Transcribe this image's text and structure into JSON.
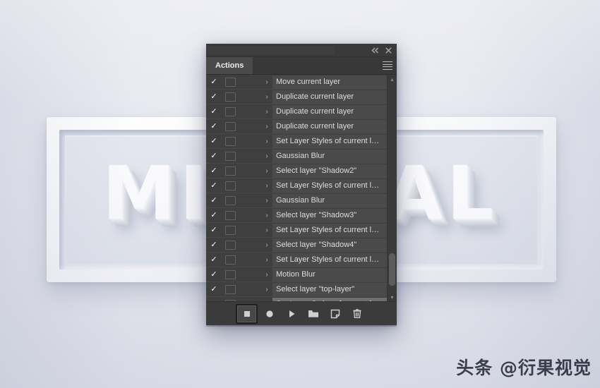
{
  "background": {
    "artwork_word": "MINIMAL",
    "frame_style": "3d-white-picture-frame",
    "base_color": "#e4e6ee"
  },
  "panel": {
    "titlebar": {
      "collapse_label": "«",
      "close_label": "✕"
    },
    "tab": {
      "label": "Actions",
      "menu_icon": "hamburger-menu-icon"
    },
    "rows": [
      {
        "checked": "✓",
        "expand": "›",
        "label": "Move current layer",
        "selected": false
      },
      {
        "checked": "✓",
        "expand": "›",
        "label": "Duplicate current layer",
        "selected": false
      },
      {
        "checked": "✓",
        "expand": "›",
        "label": "Duplicate current layer",
        "selected": false
      },
      {
        "checked": "✓",
        "expand": "›",
        "label": "Duplicate current layer",
        "selected": false
      },
      {
        "checked": "✓",
        "expand": "›",
        "label": "Set Layer Styles of current layer",
        "selected": false
      },
      {
        "checked": "✓",
        "expand": "›",
        "label": "Gaussian Blur",
        "selected": false
      },
      {
        "checked": "✓",
        "expand": "›",
        "label": "Select layer \"Shadow2\"",
        "selected": false
      },
      {
        "checked": "✓",
        "expand": "›",
        "label": "Set Layer Styles of current layer",
        "selected": false
      },
      {
        "checked": "✓",
        "expand": "›",
        "label": "Gaussian Blur",
        "selected": false
      },
      {
        "checked": "✓",
        "expand": "›",
        "label": "Select layer \"Shadow3\"",
        "selected": false
      },
      {
        "checked": "✓",
        "expand": "›",
        "label": "Set Layer Styles of current layer",
        "selected": false
      },
      {
        "checked": "✓",
        "expand": "›",
        "label": "Select layer \"Shadow4\"",
        "selected": false
      },
      {
        "checked": "✓",
        "expand": "›",
        "label": "Set Layer Styles of current layer",
        "selected": false
      },
      {
        "checked": "✓",
        "expand": "›",
        "label": "Motion Blur",
        "selected": false
      },
      {
        "checked": "✓",
        "expand": "›",
        "label": "Select layer \"top-layer\"",
        "selected": false
      },
      {
        "checked": "✓",
        "expand": "›",
        "label": "Set Layer Styles of current layer",
        "selected": true
      }
    ],
    "scrollbar": {
      "up_arrow": "▴",
      "down_arrow": "▾"
    },
    "footer_buttons": [
      {
        "name": "stop-playing-recording-button",
        "icon": "stop-square-icon",
        "active": true
      },
      {
        "name": "begin-recording-button",
        "icon": "record-circle-icon",
        "active": false
      },
      {
        "name": "play-selection-button",
        "icon": "play-triangle-icon",
        "active": false
      },
      {
        "name": "create-new-set-button",
        "icon": "folder-icon",
        "active": false
      },
      {
        "name": "create-new-action-button",
        "icon": "new-page-icon",
        "active": false
      },
      {
        "name": "delete-button",
        "icon": "trash-icon",
        "active": false
      }
    ]
  },
  "watermark": {
    "text": "头条 @衍果视觉"
  }
}
